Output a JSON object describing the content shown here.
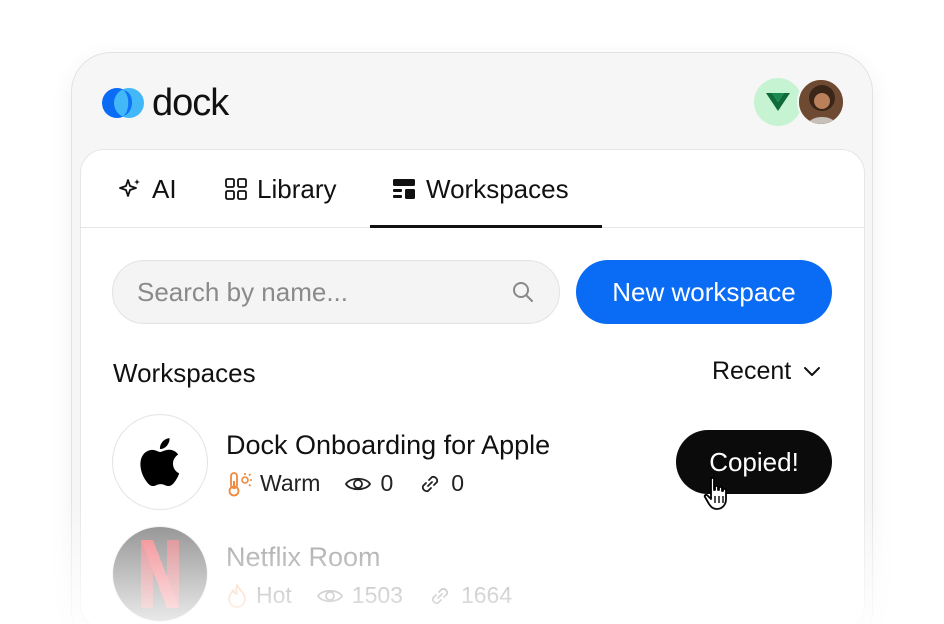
{
  "app": {
    "name": "dock"
  },
  "tabs": [
    {
      "label": "AI",
      "icon": "sparkle-icon"
    },
    {
      "label": "Library",
      "icon": "grid-icon"
    },
    {
      "label": "Workspaces",
      "icon": "workspace-icon",
      "active": true
    }
  ],
  "search": {
    "placeholder": "Search by name...",
    "value": ""
  },
  "new_button": {
    "label": "New workspace"
  },
  "section": {
    "title": "Workspaces",
    "sort_label": "Recent"
  },
  "workspaces": [
    {
      "name": "Dock Onboarding for Apple",
      "status": "Warm",
      "views": "0",
      "links": "0"
    },
    {
      "name": "Netflix Room",
      "status": "Hot",
      "views": "1503",
      "links": "1664"
    }
  ],
  "toast": {
    "label": "Copied!"
  },
  "colors": {
    "accent": "#0a6cf5",
    "warm": "#f0883e",
    "hot": "#f0883e",
    "avatar_green": "#c6f3d2"
  }
}
